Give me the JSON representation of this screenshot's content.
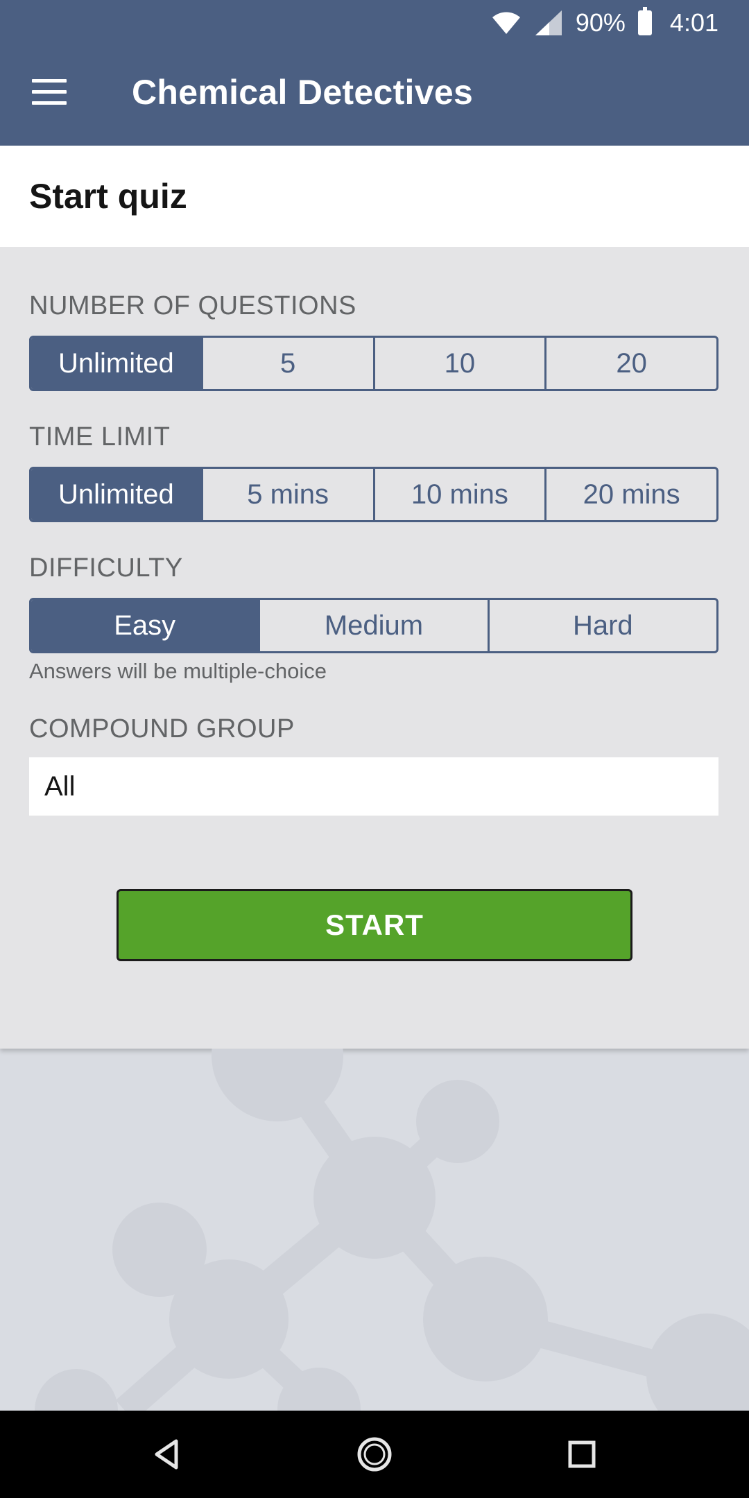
{
  "status_bar": {
    "battery": "90%",
    "time": "4:01",
    "icons": [
      "wifi-icon",
      "signal-icon",
      "battery-icon"
    ]
  },
  "app_bar": {
    "title": "Chemical Detectives",
    "menu_icon": "hamburger-menu-icon"
  },
  "card": {
    "title": "Start quiz",
    "questions": {
      "label": "NUMBER OF QUESTIONS",
      "options": [
        "Unlimited",
        "5",
        "10",
        "20"
      ],
      "selected": "Unlimited"
    },
    "time_limit": {
      "label": "TIME LIMIT",
      "options": [
        "Unlimited",
        "5 mins",
        "10 mins",
        "20 mins"
      ],
      "selected": "Unlimited"
    },
    "difficulty": {
      "label": "DIFFICULTY",
      "options": [
        "Easy",
        "Medium",
        "Hard"
      ],
      "selected": "Easy",
      "hint": "Answers will be multiple-choice"
    },
    "compound_group": {
      "label": "COMPOUND GROUP",
      "value": "All"
    },
    "start_label": "START"
  },
  "colors": {
    "primary": "#4b5f82",
    "start_button": "#55a32a",
    "card_bg": "#e4e4e6",
    "page_bg": "#d9dce2"
  },
  "nav_bar": {
    "icons": [
      "back-icon",
      "home-icon",
      "recents-icon"
    ]
  }
}
